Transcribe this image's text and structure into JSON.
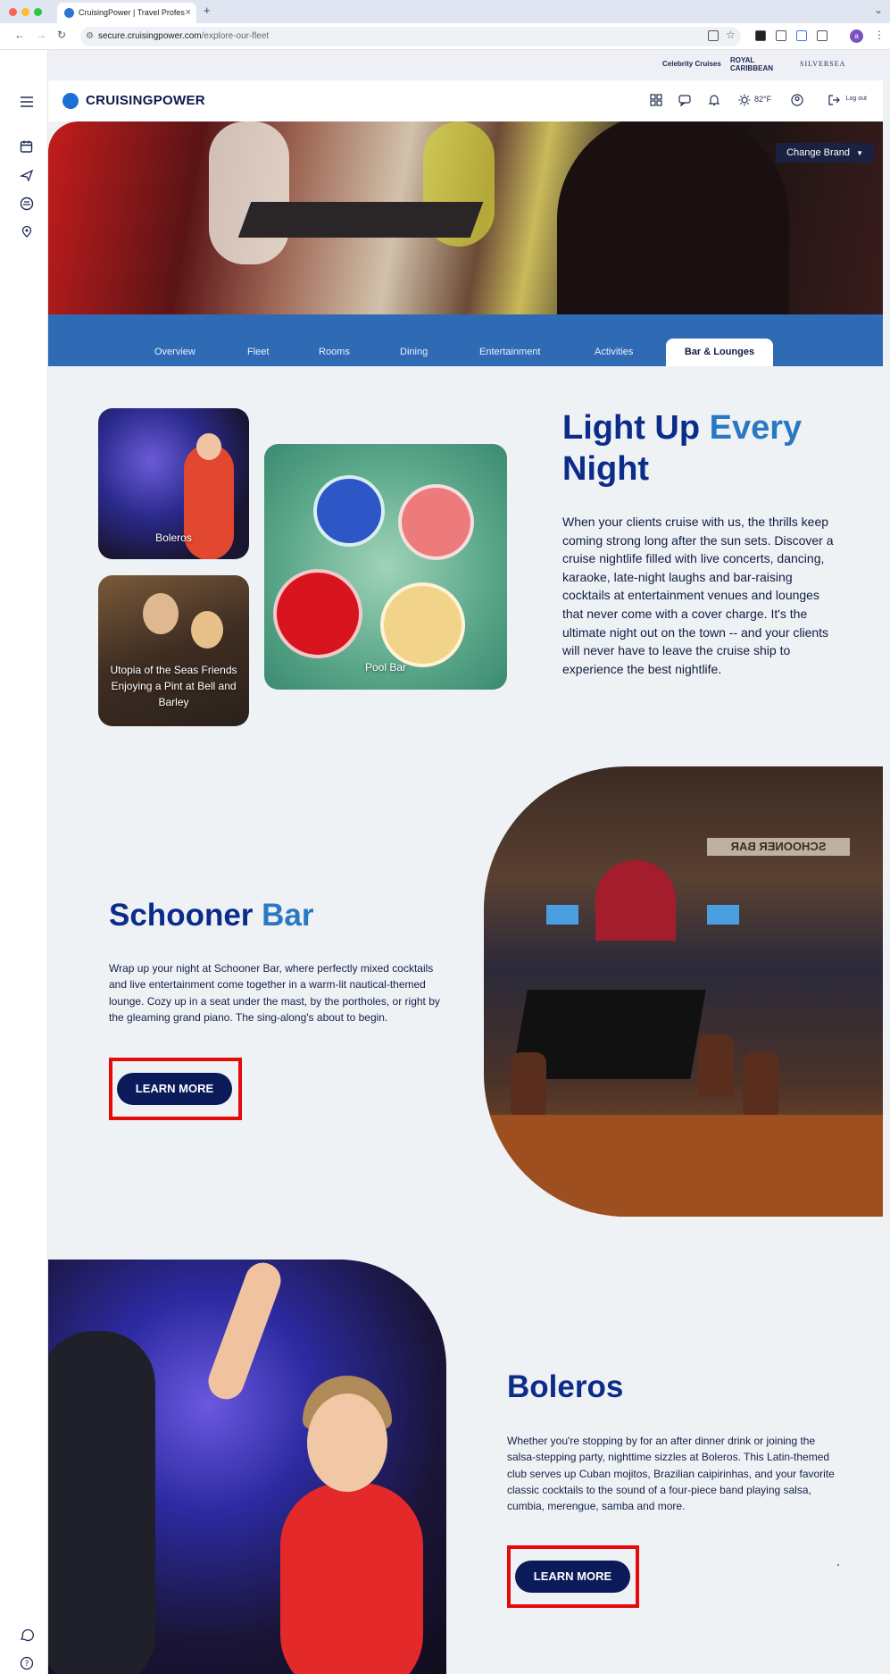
{
  "browser": {
    "tab_title": "CruisingPower | Travel Profes",
    "url_host": "secure.cruisingpower.com",
    "url_path": "/explore-our-fleet",
    "profile_initial": "a"
  },
  "brands": {
    "celebrity": "Celebrity Cruises",
    "royal": "ROYAL CARIBBEAN",
    "silversea": "SILVERSEA"
  },
  "header": {
    "logo": "CRUISINGPOWER",
    "temperature": "82°F",
    "logout": "Log out"
  },
  "hero": {
    "change_brand": "Change Brand"
  },
  "tabs": [
    {
      "label": "Overview"
    },
    {
      "label": "Fleet"
    },
    {
      "label": "Rooms"
    },
    {
      "label": "Dining"
    },
    {
      "label": "Entertainment"
    },
    {
      "label": "Activities"
    },
    {
      "label": "Bar & Lounges"
    }
  ],
  "gallery": {
    "boleros": "Boleros",
    "utopia": "Utopia of the Seas Friends Enjoying a Pint at Bell and Barley",
    "pool": "Pool Bar"
  },
  "intro": {
    "title_1": "Light",
    "title_2": "Up",
    "title_3": "Every",
    "title_4": "Night",
    "body": "When your clients cruise with us, the thrills keep coming strong long after the sun sets. Discover a cruise nightlife filled with live concerts, dancing, karaoke, late-night laughs and bar-raising cocktails at entertainment venues and lounges that never come with a cover charge. It's the ultimate night out on the town -- and your clients will never have to leave the cruise ship to experience the best nightlife."
  },
  "schooner": {
    "title_1": "Schooner",
    "title_2": "Bar",
    "body": "Wrap up your night at Schooner Bar, where perfectly mixed cocktails and live entertainment come together in a warm-lit nautical-themed lounge. Cozy up in a seat under the mast, by the portholes, or right by the gleaming grand piano. The sing-along's about to begin.",
    "button": "LEARN MORE",
    "sign": "SCHOONER BAR"
  },
  "boleros": {
    "title": "Boleros",
    "body": "Whether you're stopping by for an after dinner drink or joining the salsa-stepping party, nighttime sizzles at Boleros. This Latin-themed club serves up Cuban mojitos, Brazilian caipirinhas, and your favorite classic cocktails to the sound of a four-piece band playing salsa, cumbia, merengue, samba and more.",
    "button": "LEARN MORE"
  }
}
